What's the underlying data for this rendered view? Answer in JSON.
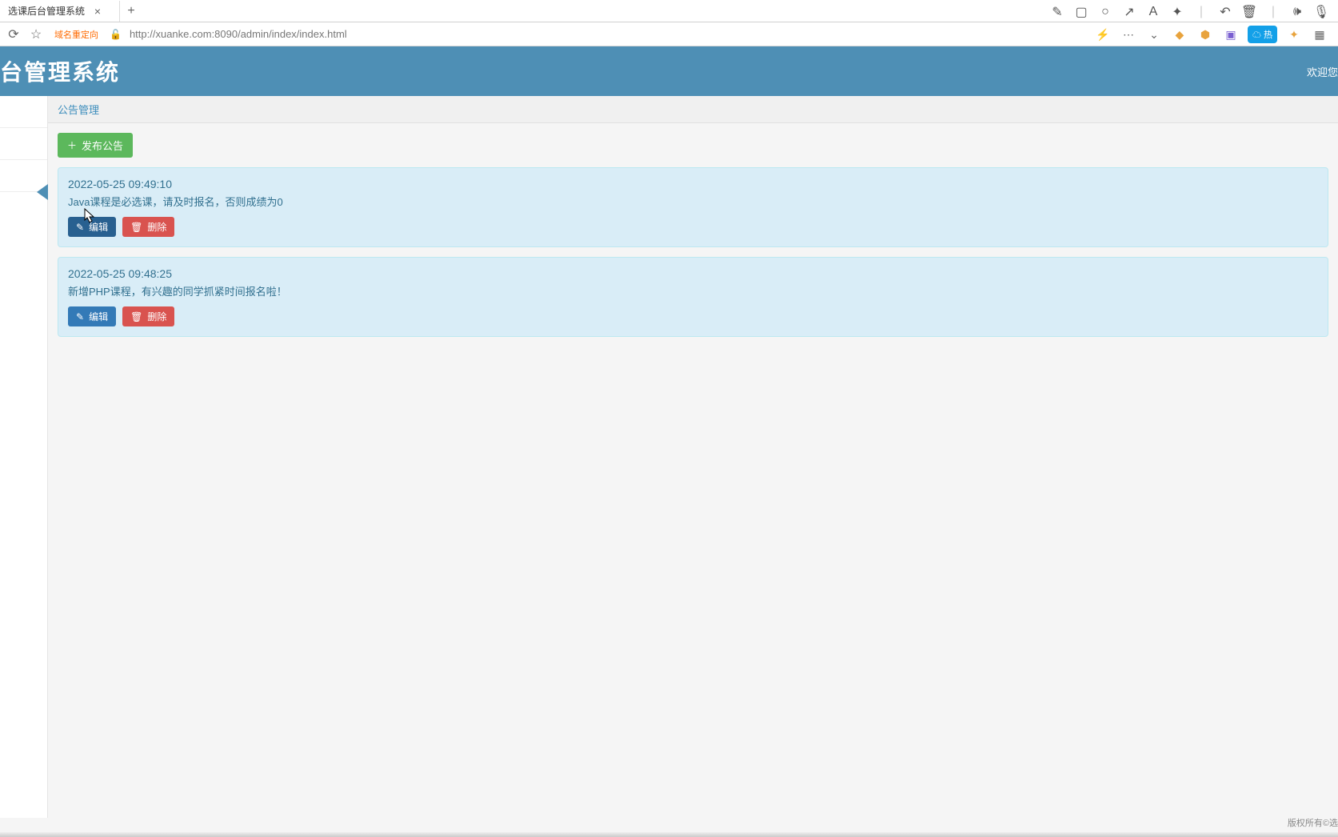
{
  "browser": {
    "tab_title": "选课后台管理系统",
    "url": "http://xuanke.com:8090/admin/index/index.html",
    "redirect_tag": "域名重定向"
  },
  "header": {
    "title": "台管理系统",
    "welcome": "欢迎您"
  },
  "breadcrumb": "公告管理",
  "buttons": {
    "publish": "发布公告",
    "edit": "编辑",
    "delete": "删除"
  },
  "notices": [
    {
      "time": "2022-05-25 09:49:10",
      "content": "Java课程是必选课，请及时报名，否则成绩为0"
    },
    {
      "time": "2022-05-25 09:48:25",
      "content": "新增PHP课程，有兴趣的同学抓紧时间报名啦！"
    }
  ],
  "footer": "版权所有©选"
}
